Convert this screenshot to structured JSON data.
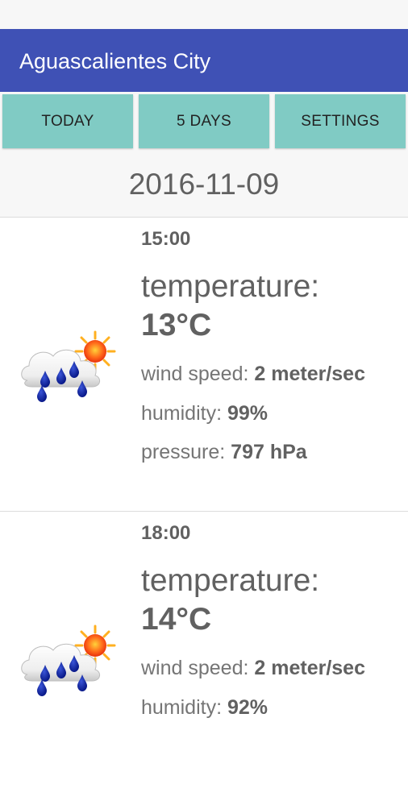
{
  "app_bar": {
    "title": "Aguascalientes City",
    "color": "#3f51b5"
  },
  "tabs": [
    {
      "label": "TODAY"
    },
    {
      "label": "5 DAYS"
    },
    {
      "label": "SETTINGS"
    }
  ],
  "tab_color": "#80cbc4",
  "date": "2016-11-09",
  "labels": {
    "temperature": "temperature:",
    "wind_speed": "wind speed:",
    "humidity": "humidity:",
    "pressure": "pressure:"
  },
  "forecasts": [
    {
      "time": "15:00",
      "icon": "rain-cloud-sun-icon",
      "temperature": "13°C",
      "wind_speed": "2 meter/sec",
      "humidity": "99%",
      "pressure": "797 hPa"
    },
    {
      "time": "18:00",
      "icon": "rain-cloud-sun-icon",
      "temperature": "14°C",
      "wind_speed": "2 meter/sec",
      "humidity": "92%"
    }
  ]
}
